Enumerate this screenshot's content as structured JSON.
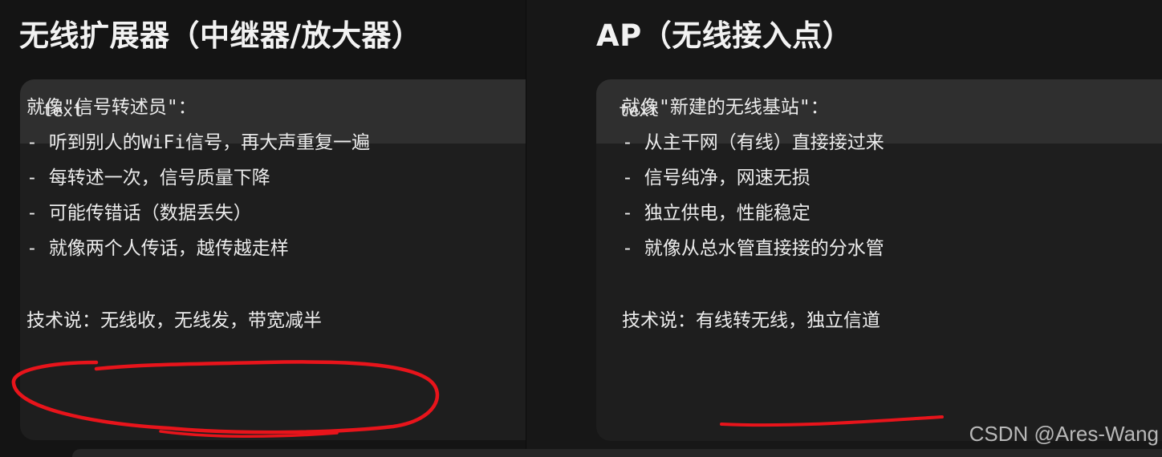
{
  "left_panel": {
    "title": "无线扩展器（中继器/放大器）",
    "code_lang": "text",
    "lines": [
      "就像\"信号转述员\"：",
      "- 听到别人的WiFi信号，再大声重复一遍",
      "- 每转述一次，信号质量下降",
      "- 可能传错话（数据丢失）",
      "- 就像两个人传话，越传越走样",
      "",
      "技术说：无线收，无线发，带宽减半"
    ]
  },
  "right_panel": {
    "title": "AP（无线接入点）",
    "code_lang": "text",
    "lines": [
      "就像\"新建的无线基站\"：",
      "- 从主干网（有线）直接接过来",
      "- 信号纯净，网速无损",
      "- 独立供电，性能稳定",
      "- 就像从总水管直接接的分水管",
      "",
      "技术说：有线转无线，独立信道"
    ]
  },
  "watermark": "CSDN @Ares-Wang",
  "colors": {
    "background": "#141414",
    "code_header": "#2f2f2f",
    "code_body": "#1e1e1e",
    "annotation": "#e8141b",
    "text": "#ececec"
  }
}
